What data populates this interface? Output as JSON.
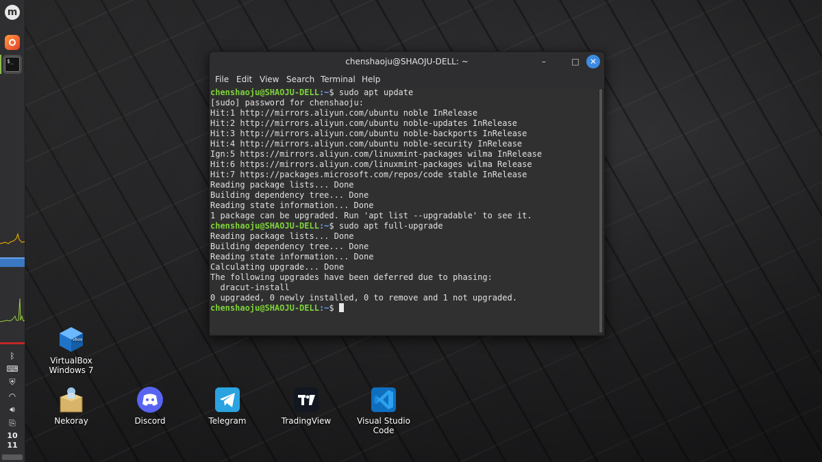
{
  "desktop": {
    "icons": [
      {
        "label": "VirtualBox\nWindows 7",
        "icon": "virtualbox-icon"
      },
      {
        "label": "Nekoray",
        "icon": "nekoray-icon"
      },
      {
        "label": "Discord",
        "icon": "discord-icon"
      },
      {
        "label": "Telegram",
        "icon": "telegram-icon"
      },
      {
        "label": "TradingView",
        "icon": "tradingview-icon"
      },
      {
        "label": "Visual Studio\nCode",
        "icon": "vscode-icon"
      }
    ]
  },
  "panel": {
    "menu_icon": "linux-mint-menu-icon",
    "launchers": [
      "firefox-icon",
      "terminal-icon"
    ],
    "terminal_glyph": "$_",
    "tray": [
      "bluetooth-icon",
      "keyboard-icon",
      "shield-icon",
      "wifi-icon",
      "volume-icon",
      "clipboard-icon"
    ],
    "clock": {
      "hour": "10",
      "minute": "11"
    }
  },
  "terminal": {
    "title": "chenshaoju@SHAOJU-DELL: ~",
    "menu": [
      "File",
      "Edit",
      "View",
      "Search",
      "Terminal",
      "Help"
    ],
    "prompt_user": "chenshaoju@SHAOJU-DELL",
    "prompt_path": ":~",
    "prompt_symbol": "$",
    "lines": [
      {
        "type": "prompt",
        "cmd": " sudo apt update"
      },
      {
        "type": "out",
        "text": "[sudo] password for chenshaoju:"
      },
      {
        "type": "out",
        "text": "Hit:1 http://mirrors.aliyun.com/ubuntu noble InRelease"
      },
      {
        "type": "out",
        "text": "Hit:2 http://mirrors.aliyun.com/ubuntu noble-updates InRelease"
      },
      {
        "type": "out",
        "text": "Hit:3 http://mirrors.aliyun.com/ubuntu noble-backports InRelease"
      },
      {
        "type": "out",
        "text": "Hit:4 http://mirrors.aliyun.com/ubuntu noble-security InRelease"
      },
      {
        "type": "out",
        "text": "Ign:5 https://mirrors.aliyun.com/linuxmint-packages wilma InRelease"
      },
      {
        "type": "out",
        "text": "Hit:6 https://mirrors.aliyun.com/linuxmint-packages wilma Release"
      },
      {
        "type": "out",
        "text": "Hit:7 https://packages.microsoft.com/repos/code stable InRelease"
      },
      {
        "type": "out",
        "text": "Reading package lists... Done"
      },
      {
        "type": "out",
        "text": "Building dependency tree... Done"
      },
      {
        "type": "out",
        "text": "Reading state information... Done"
      },
      {
        "type": "out",
        "text": "1 package can be upgraded. Run 'apt list --upgradable' to see it."
      },
      {
        "type": "prompt",
        "cmd": " sudo apt full-upgrade"
      },
      {
        "type": "out",
        "text": "Reading package lists... Done"
      },
      {
        "type": "out",
        "text": "Building dependency tree... Done"
      },
      {
        "type": "out",
        "text": "Reading state information... Done"
      },
      {
        "type": "out",
        "text": "Calculating upgrade... Done"
      },
      {
        "type": "out",
        "text": "The following upgrades have been deferred due to phasing:"
      },
      {
        "type": "out",
        "text": "  dracut-install"
      },
      {
        "type": "out",
        "text": "0 upgraded, 0 newly installed, 0 to remove and 1 not upgraded."
      },
      {
        "type": "prompt",
        "cmd": " ",
        "cursor": true
      }
    ]
  },
  "colors": {
    "prompt_user": "#7fd23a",
    "prompt_path": "#6da3ff",
    "close_button": "#3d8be3"
  }
}
